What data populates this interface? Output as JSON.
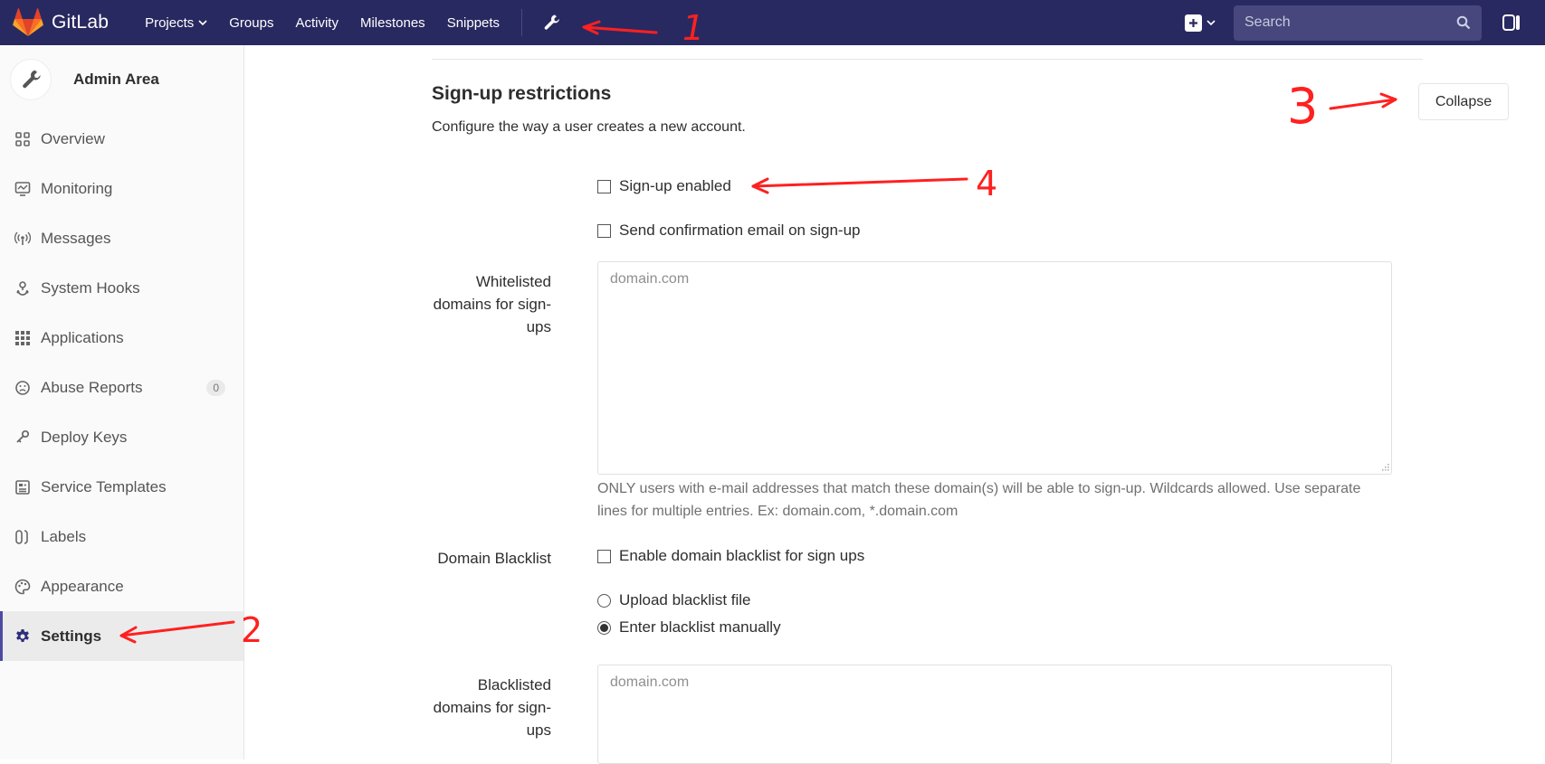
{
  "navbar": {
    "brand": "GitLab",
    "links": [
      {
        "label": "Projects"
      },
      {
        "label": "Groups"
      },
      {
        "label": "Activity"
      },
      {
        "label": "Milestones"
      },
      {
        "label": "Snippets"
      }
    ],
    "search_placeholder": "Search",
    "icons": [
      "gitlab-logo-icon",
      "wrench-icon",
      "plus-square-icon",
      "search-icon",
      "issues-icon"
    ]
  },
  "sidebar": {
    "title": "Admin Area",
    "items": [
      {
        "label": "Overview",
        "icon": "grid-icon"
      },
      {
        "label": "Monitoring",
        "icon": "monitor-icon"
      },
      {
        "label": "Messages",
        "icon": "broadcast-icon"
      },
      {
        "label": "System Hooks",
        "icon": "hook-icon"
      },
      {
        "label": "Applications",
        "icon": "apps-grid-icon"
      },
      {
        "label": "Abuse Reports",
        "icon": "frown-icon",
        "badge": "0"
      },
      {
        "label": "Deploy Keys",
        "icon": "key-icon"
      },
      {
        "label": "Service Templates",
        "icon": "template-icon"
      },
      {
        "label": "Labels",
        "icon": "labels-icon"
      },
      {
        "label": "Appearance",
        "icon": "palette-icon"
      },
      {
        "label": "Settings",
        "icon": "gear-icon",
        "active": true
      }
    ]
  },
  "main": {
    "section_title": "Sign-up restrictions",
    "section_desc": "Configure the way a user creates a new account.",
    "collapse_label": "Collapse",
    "signup_enabled": {
      "label": "Sign-up enabled",
      "checked": false
    },
    "send_confirmation": {
      "label": "Send confirmation email on sign-up",
      "checked": false
    },
    "whitelist": {
      "label_lines": [
        "Whitelisted",
        "domains for sign-",
        "ups"
      ],
      "placeholder": "domain.com",
      "value": "",
      "help": "ONLY users with e-mail addresses that match these domain(s) will be able to sign-up. Wildcards allowed. Use separate lines for multiple entries. Ex: domain.com, *.domain.com"
    },
    "blacklist": {
      "label": "Domain Blacklist",
      "enable_label": "Enable domain blacklist for sign ups",
      "enable_checked": false,
      "upload_label": "Upload blacklist file",
      "manual_label": "Enter blacklist manually",
      "selected": "manual"
    },
    "blacklisted_domains": {
      "label_lines": [
        "Blacklisted",
        "domains for sign-",
        "ups"
      ],
      "placeholder": "domain.com",
      "value": ""
    }
  },
  "annotations": {
    "numbers": [
      "1",
      "2",
      "3",
      "4"
    ],
    "color": "#ff2020"
  },
  "colors": {
    "navbar": "#292961",
    "search": "#47477d",
    "active_indicator": "#4b4ba3",
    "logo_orange": "#e24329"
  }
}
